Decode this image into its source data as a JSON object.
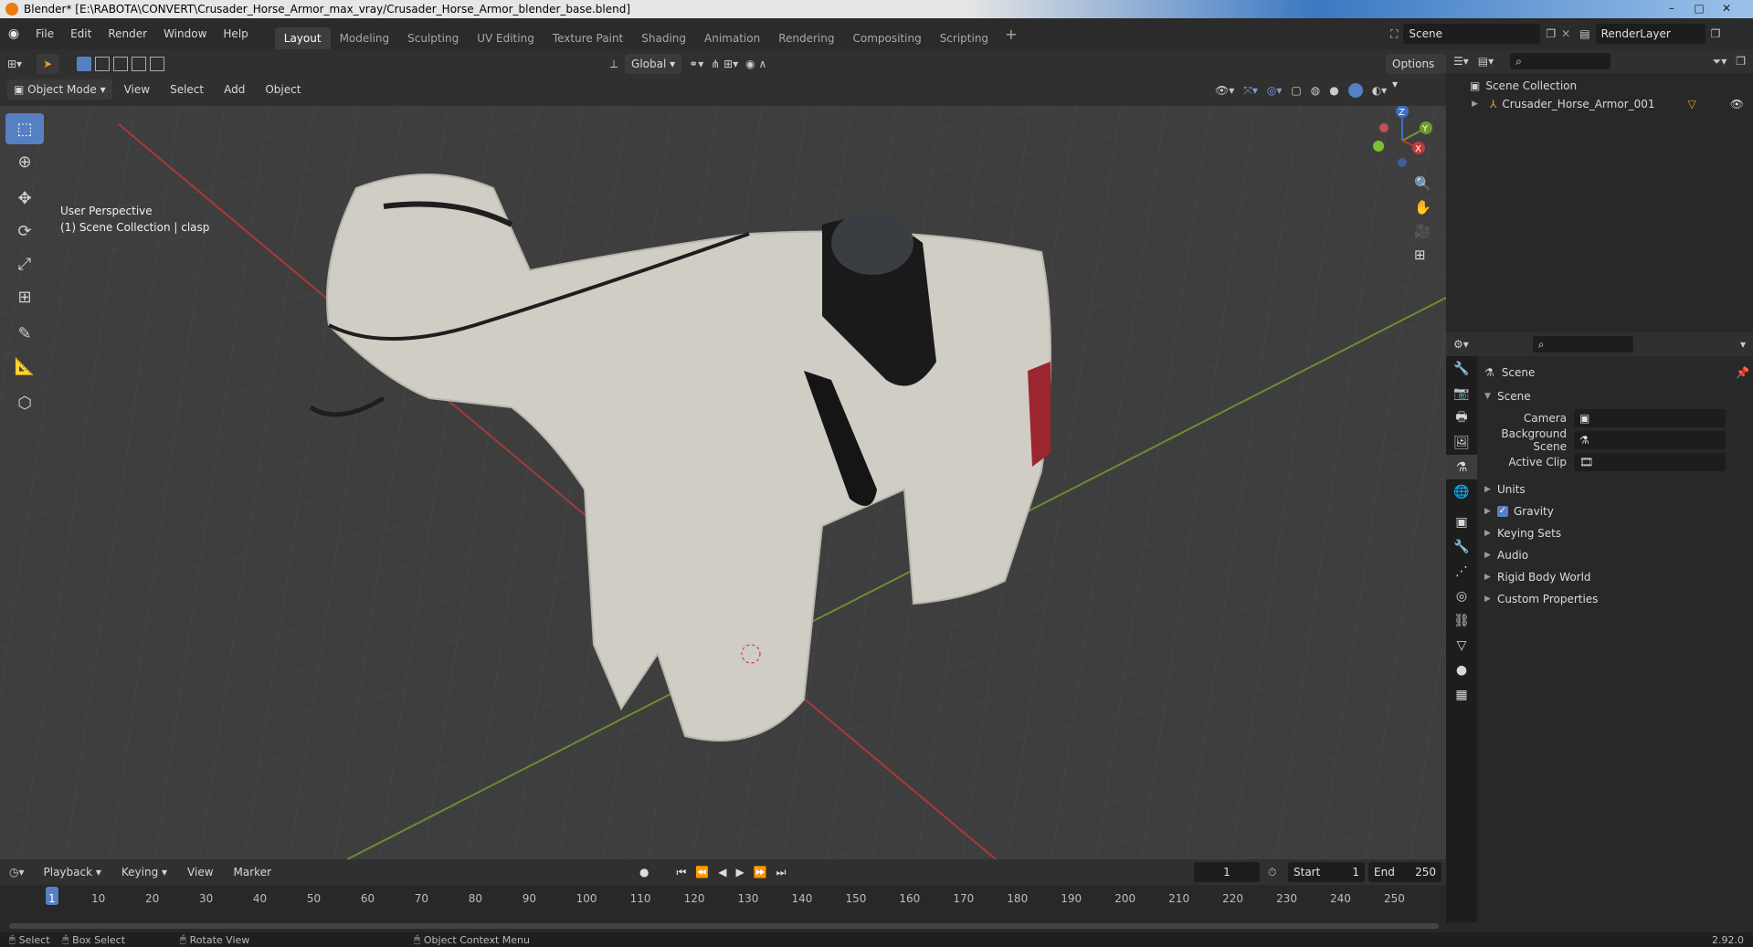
{
  "window": {
    "title": "Blender* [E:\\RABOTA\\CONVERT\\Crusader_Horse_Armor_max_vray/Crusader_Horse_Armor_blender_base.blend]",
    "minimize": "–",
    "maximize": "□",
    "close": "✕"
  },
  "menu": {
    "file": "File",
    "edit": "Edit",
    "render": "Render",
    "window": "Window",
    "help": "Help"
  },
  "workspaces": [
    "Layout",
    "Modeling",
    "Sculpting",
    "UV Editing",
    "Texture Paint",
    "Shading",
    "Animation",
    "Rendering",
    "Compositing",
    "Scripting"
  ],
  "add_workspace": "+",
  "scene_field": "Scene",
  "render_layer_field": "RenderLayer",
  "viewport_header": {
    "mode": "Object Mode",
    "view": "View",
    "select": "Select",
    "add": "Add",
    "object": "Object",
    "orientation": "Global",
    "options": "Options"
  },
  "viewport": {
    "perspective": "User Perspective",
    "collection_info": "(1) Scene Collection | clasp",
    "gizmo": {
      "z": "Z",
      "y": "Y",
      "x": "X"
    }
  },
  "outliner": {
    "root": "Scene Collection",
    "item": "Crusader_Horse_Armor_001"
  },
  "properties": {
    "context": "Scene",
    "panel": "Scene",
    "camera_label": "Camera",
    "background_label": "Background Scene",
    "clip_label": "Active Clip",
    "sections": [
      "Units",
      "Gravity",
      "Keying Sets",
      "Audio",
      "Rigid Body World",
      "Custom Properties"
    ],
    "gravity_checked": true
  },
  "timeline": {
    "playback": "Playback",
    "keying": "Keying",
    "view": "View",
    "marker": "Marker",
    "current_frame": "1",
    "start_label": "Start",
    "start": "1",
    "end_label": "End",
    "end": "250",
    "frames": [
      "1",
      "10",
      "20",
      "30",
      "40",
      "50",
      "60",
      "70",
      "80",
      "90",
      "100",
      "110",
      "120",
      "130",
      "140",
      "150",
      "160",
      "170",
      "180",
      "190",
      "200",
      "210",
      "220",
      "230",
      "240",
      "250"
    ]
  },
  "status": {
    "select": "Select",
    "box_select": "Box Select",
    "rotate_view": "Rotate View",
    "context_menu": "Object Context Menu",
    "version": "2.92.0"
  },
  "colors": {
    "accent": "#5680c2",
    "axis_x": "#c03a3a",
    "axis_y": "#6e9a2a",
    "axis_z": "#3a6ec8",
    "blender_orange": "#e87d0d"
  }
}
